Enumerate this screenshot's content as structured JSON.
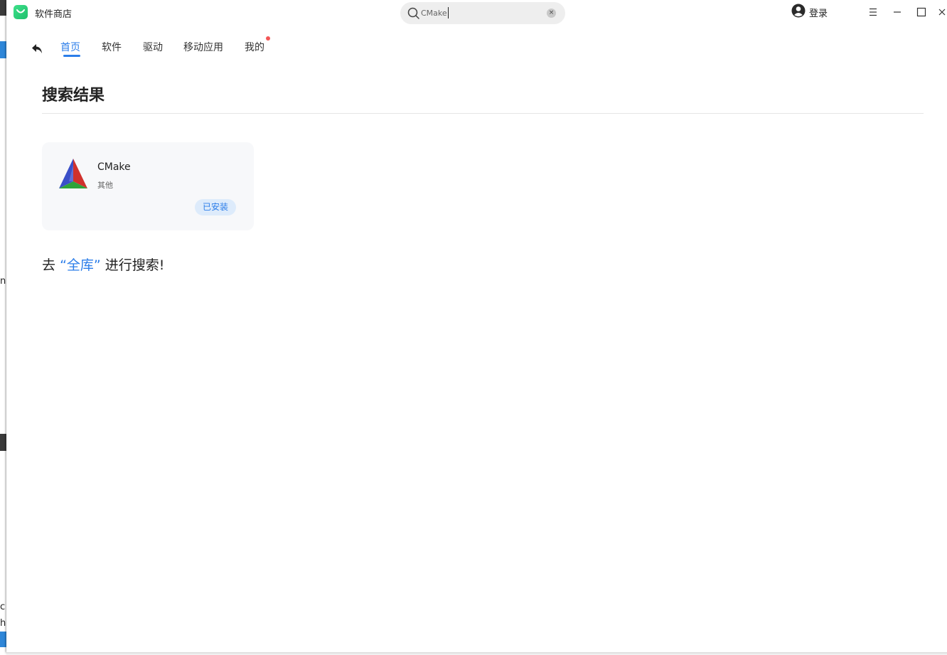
{
  "app": {
    "title": "软件商店"
  },
  "search": {
    "value": "CMake",
    "clear_icon": "×"
  },
  "account": {
    "login_label": "登录"
  },
  "nav": {
    "items": [
      {
        "label": "首页"
      },
      {
        "label": "软件"
      },
      {
        "label": "驱动"
      },
      {
        "label": "移动应用"
      },
      {
        "label": "我的"
      }
    ]
  },
  "page": {
    "title": "搜索结果"
  },
  "results": [
    {
      "name": "CMake",
      "category": "其他",
      "status": "已安装"
    }
  ],
  "search_all": {
    "prefix": "去",
    "link": "“全库”",
    "suffix": "进行搜索!"
  },
  "desktop": {
    "chars": [
      "n",
      "c",
      "h"
    ]
  },
  "colors": {
    "accent": "#2b7de9",
    "badge_bg": "#ddebfb",
    "notification_dot": "#f35656",
    "app_icon": "#2fd17b"
  },
  "icons": {
    "app": "store-bag-icon",
    "search": "search-icon",
    "clear": "close-circle-icon",
    "user": "user-avatar-icon",
    "menu": "hamburger-menu-icon",
    "minimize": "minimize-icon",
    "maximize": "maximize-icon",
    "close": "close-icon",
    "back": "back-arrow-icon",
    "result": "cmake-logo-icon"
  }
}
